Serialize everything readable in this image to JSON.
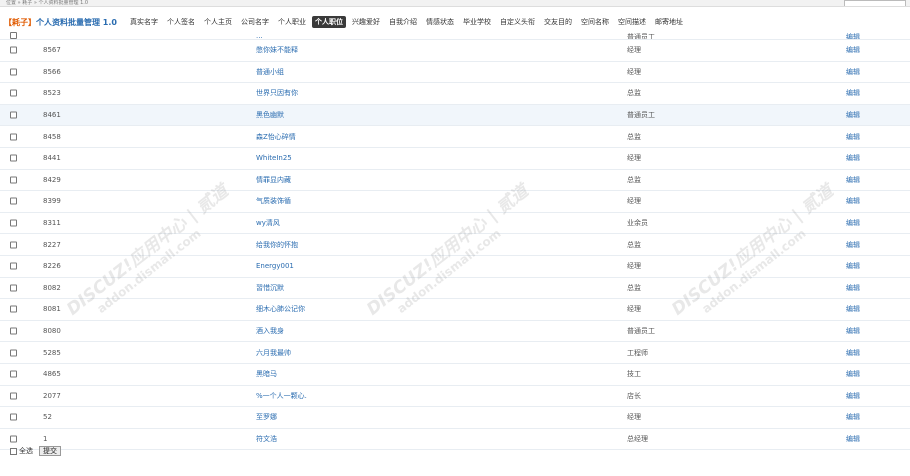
{
  "topbar": {
    "breadcrumb": "位置 » 耗子 » 个人资料批量管理 1.0"
  },
  "header": {
    "brand": "【耗子】",
    "title": "个人资料批量管理 1.0",
    "tabs": [
      {
        "label": "真实名字"
      },
      {
        "label": "个人签名"
      },
      {
        "label": "个人主页"
      },
      {
        "label": "公司名字"
      },
      {
        "label": "个人职业"
      },
      {
        "label": "个人职位"
      },
      {
        "label": "兴趣爱好"
      },
      {
        "label": "自我介绍"
      },
      {
        "label": "情感状态"
      },
      {
        "label": "毕业学校"
      },
      {
        "label": "自定义头衔"
      },
      {
        "label": "交友目的"
      },
      {
        "label": "空间名称"
      },
      {
        "label": "空间描述"
      },
      {
        "label": "邮寄地址"
      }
    ],
    "active_tab": "个人职位"
  },
  "rows": [
    {
      "uid": "8567",
      "value": "憋你妹不能释",
      "job": "经理",
      "edit": "编辑"
    },
    {
      "uid": "8566",
      "value": "普通小组",
      "job": "经理",
      "edit": "编辑"
    },
    {
      "uid": "8523",
      "value": "世界只因有你",
      "job": "总监",
      "edit": "编辑"
    },
    {
      "uid": "8461",
      "value": "黑色幽默",
      "job": "普通员工",
      "edit": "编辑"
    },
    {
      "uid": "8458",
      "value": "森Z怡心碎情",
      "job": "总监",
      "edit": "编辑"
    },
    {
      "uid": "8441",
      "value": "WhiteIn25",
      "job": "经理",
      "edit": "编辑"
    },
    {
      "uid": "8429",
      "value": "情罪显内藏",
      "job": "总监",
      "edit": "编辑"
    },
    {
      "uid": "8399",
      "value": "气质装饰循",
      "job": "经理",
      "edit": "编辑"
    },
    {
      "uid": "8311",
      "value": "wy清风",
      "job": "业余员",
      "edit": "编辑"
    },
    {
      "uid": "8227",
      "value": "给我你的怀抱",
      "job": "总监",
      "edit": "编辑"
    },
    {
      "uid": "8226",
      "value": "Energy001",
      "job": "经理",
      "edit": "编辑"
    },
    {
      "uid": "8082",
      "value": "習惜沉默",
      "job": "总监",
      "edit": "编辑"
    },
    {
      "uid": "8081",
      "value": "细木心肺公记你",
      "job": "经理",
      "edit": "编辑"
    },
    {
      "uid": "8080",
      "value": "酒入我身",
      "job": "普通员工",
      "edit": "编辑"
    },
    {
      "uid": "5285",
      "value": "六月我最帅",
      "job": "工程师",
      "edit": "编辑"
    },
    {
      "uid": "4865",
      "value": "黑暗马",
      "job": "技工",
      "edit": "编辑"
    },
    {
      "uid": "2077",
      "value": "%一个人一颗心.",
      "job": "店长",
      "edit": "编辑"
    },
    {
      "uid": "52",
      "value": "至罗娜",
      "job": "经理",
      "edit": "编辑"
    },
    {
      "uid": "1",
      "value": "符文浩",
      "job": "总经理",
      "edit": "编辑"
    }
  ],
  "partial_row": {
    "value": "...",
    "job": "普通员工",
    "edit": "编辑"
  },
  "footer": {
    "select_all": "全选",
    "submit": "提交"
  },
  "watermark": {
    "main": "DISCUZ!应用中心 | 贰道",
    "sub": "addon.dismall.com"
  }
}
